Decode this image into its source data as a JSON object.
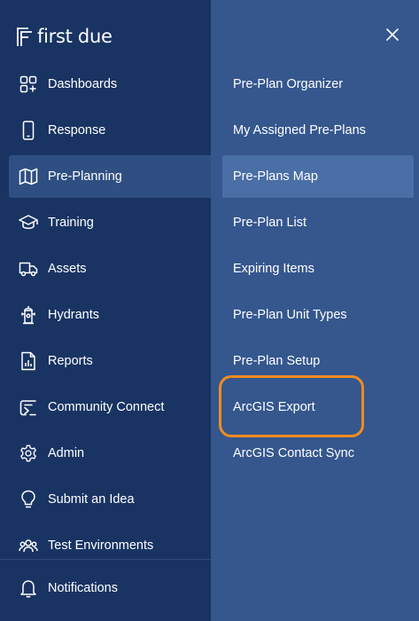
{
  "brand": {
    "name": "first due"
  },
  "nav": {
    "items": [
      {
        "label": "Dashboards",
        "icon": "dashboard-grid-icon",
        "active": false
      },
      {
        "label": "Response",
        "icon": "mobile-phone-icon",
        "active": false
      },
      {
        "label": "Pre-Planning",
        "icon": "map-icon",
        "active": true
      },
      {
        "label": "Training",
        "icon": "graduation-cap-icon",
        "active": false
      },
      {
        "label": "Assets",
        "icon": "truck-icon",
        "active": false
      },
      {
        "label": "Hydrants",
        "icon": "hydrant-icon",
        "active": false
      },
      {
        "label": "Reports",
        "icon": "report-chart-icon",
        "active": false
      },
      {
        "label": "Community Connect",
        "icon": "community-connect-icon",
        "active": false
      },
      {
        "label": "Admin",
        "icon": "gear-icon",
        "active": false
      },
      {
        "label": "Submit an Idea",
        "icon": "lightbulb-icon",
        "active": false
      },
      {
        "label": "Test Environments",
        "icon": "users-group-icon",
        "active": false
      }
    ],
    "notifications": {
      "label": "Notifications",
      "icon": "bell-icon"
    }
  },
  "submenu": {
    "items": [
      {
        "label": "Pre-Plan Organizer",
        "active": false
      },
      {
        "label": "My Assigned Pre-Plans",
        "active": false
      },
      {
        "label": "Pre-Plans Map",
        "active": true
      },
      {
        "label": "Pre-Plan List",
        "active": false
      },
      {
        "label": "Expiring Items",
        "active": false
      },
      {
        "label": "Pre-Plan Unit Types",
        "active": false
      },
      {
        "label": "Pre-Plan Setup",
        "active": false
      },
      {
        "label": "ArcGIS Export",
        "active": false
      },
      {
        "label": "ArcGIS Contact Sync",
        "active": false
      }
    ]
  },
  "colors": {
    "left_panel": "#193463",
    "right_panel": "#35578e",
    "active_nav": "#2f4f82",
    "active_sub": "#4a6ea6",
    "highlight": "#f28c1e"
  }
}
